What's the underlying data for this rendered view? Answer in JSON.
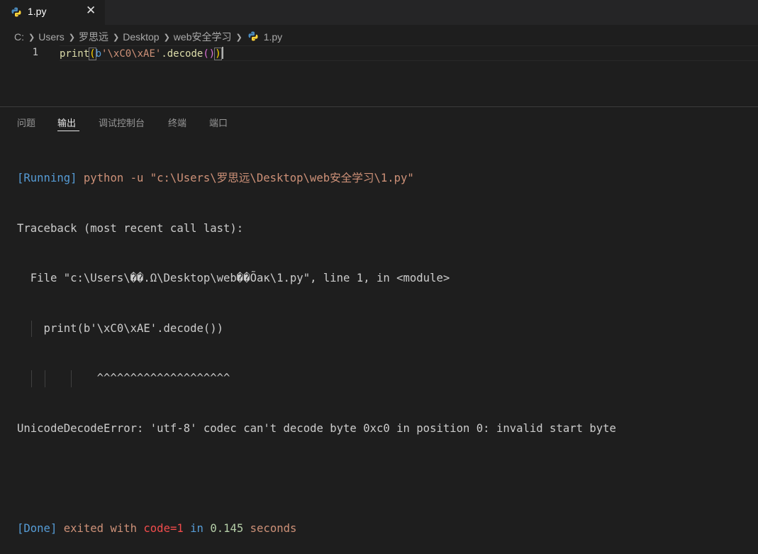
{
  "tab": {
    "label": "1.py",
    "close": "✕"
  },
  "breadcrumb": {
    "items": [
      "C:",
      "Users",
      "罗思远",
      "Desktop",
      "web安全学习"
    ],
    "file": "1.py"
  },
  "editor": {
    "line_number": "1",
    "code": {
      "fn": "print",
      "open": "(",
      "prefix": "b",
      "string": "'\\xC0\\xAE'",
      "method": ".decode",
      "inner": "()",
      "close": ")"
    }
  },
  "panel": {
    "tabs": [
      "问题",
      "输出",
      "调试控制台",
      "终端",
      "端口"
    ],
    "active_tab": "输出"
  },
  "output": {
    "running_tag": "[Running]",
    "running_cmd": " python -u \"c:\\Users\\罗思远\\Desktop\\web安全学习\\1.py\"",
    "traceback": "Traceback (most recent call last):",
    "file_line": "  File \"c:\\Users\\��.Ω\\Desktop\\web��Õак\\1.py\", line 1, in <module>",
    "code_line": "    print(b'\\xC0\\xAE'.decode())",
    "carets": "            ^^^^^^^^^^^^^^^^^^^^",
    "error": "UnicodeDecodeError: 'utf-8' codec can't decode byte 0xc0 in position 0: invalid start byte",
    "done_tag": "[Done]",
    "done_exit": " exited with ",
    "done_code": "code=1",
    "done_in": " in ",
    "done_time": "0.145",
    "done_seconds": " seconds"
  },
  "colors": {
    "background": "#1e1e1e",
    "tab_bar": "#252526",
    "keyword_blue": "#569cd6",
    "string_orange": "#ce9178",
    "error_red": "#f14c4c",
    "number_green": "#b5cea8"
  }
}
